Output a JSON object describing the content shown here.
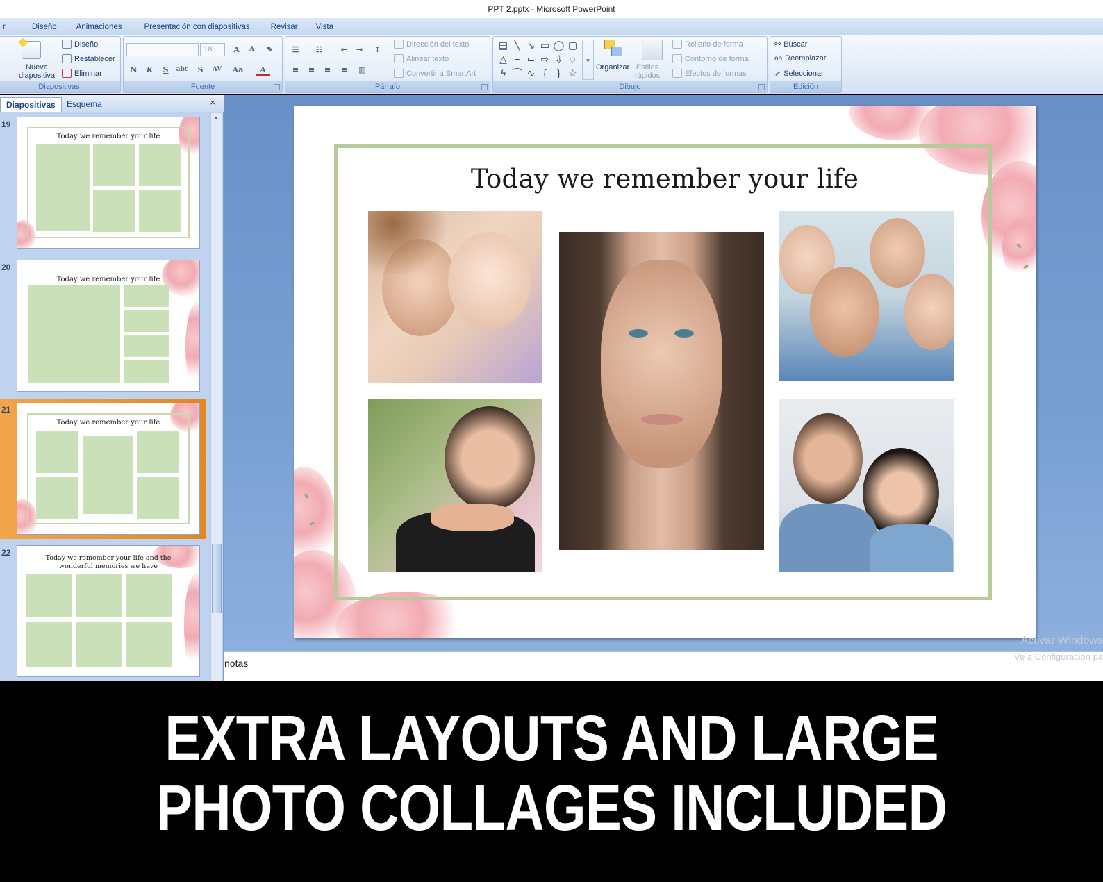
{
  "window": {
    "title": "PPT 2.pptx - Microsoft PowerPoint"
  },
  "ribbon_tabs": [
    "r",
    "Diseño",
    "Animaciones",
    "Presentación con diapositivas",
    "Revisar",
    "Vista"
  ],
  "groups": {
    "slides": {
      "label": "Diapositivas",
      "new_slide": "Nueva",
      "new_slide_2": "diapositiva",
      "layout": "Diseño",
      "reset": "Restablecer",
      "delete": "Eliminar"
    },
    "font": {
      "label": "Fuente",
      "size": "18"
    },
    "paragraph": {
      "label": "Párrafo",
      "text_direction": "Dirección del texto",
      "align_text": "Alinear texto",
      "smartart": "Convertir a SmartArt"
    },
    "drawing": {
      "label": "Dibujo",
      "arrange": "Organizar",
      "styles": "Estilos",
      "styles_2": "rápidos",
      "fill": "Relleno de forma",
      "outline": "Contorno de forma",
      "effects": "Efectos de formas"
    },
    "editing": {
      "label": "Edición",
      "find": "Buscar",
      "replace": "Reemplazar",
      "select": "Seleccionar"
    }
  },
  "panel": {
    "tab_slides": "Diapositivas",
    "tab_outline": "Esquema",
    "close": "×",
    "slides": [
      {
        "number": "19",
        "title": "Today we remember your life"
      },
      {
        "number": "20",
        "title": "Today we remember your life"
      },
      {
        "number": "21",
        "title": "Today we remember your life",
        "selected": true
      },
      {
        "number": "22",
        "title_line1": "Today we remember your life and the",
        "title_line2": "wonderful memories we have"
      }
    ]
  },
  "slide": {
    "title": "Today we remember your life",
    "photos": [
      "mother-and-baby-photo",
      "woman-portrait-photo",
      "family-photo",
      "smiling-woman-photo",
      "couple-photo"
    ]
  },
  "notes": {
    "placeholder": "notas"
  },
  "watermark": {
    "line1": "Activar Windows",
    "line2": "Ve a Configuración pa"
  },
  "caption": {
    "line1": "EXTRA LAYOUTS AND LARGE",
    "line2": "PHOTO COLLAGES INCLUDED"
  },
  "colors": {
    "accent_frame": "#b9c99c",
    "placeholder_green": "#c9e0b8",
    "selection_orange": "#f0a040",
    "ribbon_blue": "#15428b"
  }
}
